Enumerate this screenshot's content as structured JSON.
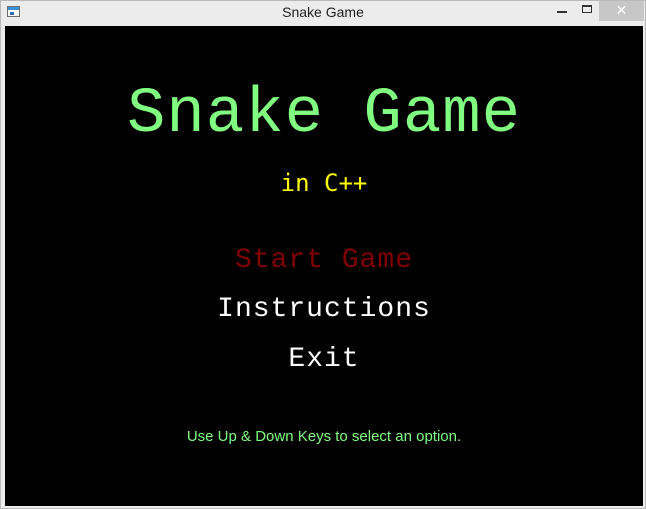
{
  "window": {
    "title": "Snake Game",
    "close_glyph": "✕"
  },
  "game": {
    "title": "Snake Game",
    "subtitle": "in C++",
    "menu": [
      {
        "label": "Start Game",
        "selected": true
      },
      {
        "label": "Instructions",
        "selected": false
      },
      {
        "label": "Exit",
        "selected": false
      }
    ],
    "hint": "Use Up & Down Keys to select an option."
  },
  "colors": {
    "background": "#000000",
    "title": "#80ff80",
    "subtitle": "#ffff00",
    "menu_selected": "#800000",
    "menu_normal": "#ffffff",
    "hint": "#80ff80"
  },
  "icons": {
    "app": "window-icon",
    "minimize": "minimize-icon",
    "maximize": "maximize-icon",
    "close": "close-icon"
  }
}
